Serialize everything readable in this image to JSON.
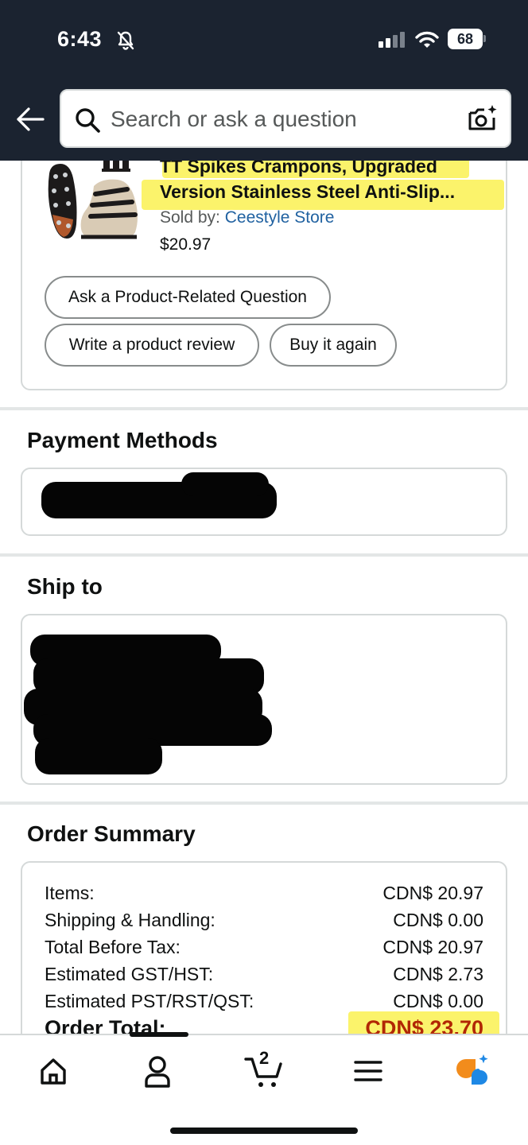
{
  "status_bar": {
    "time": "6:43",
    "battery": "68"
  },
  "search": {
    "placeholder": "Search or ask a question"
  },
  "product": {
    "title_line1": "TT Spikes Crampons, Upgraded",
    "title_line2": "Version Stainless Steel Anti-Slip...",
    "sold_by_label": "Sold by:",
    "seller": "Ceestyle Store",
    "price": "$20.97",
    "image_icon": "crampon-product-image"
  },
  "actions": {
    "ask_question": "Ask a Product-Related Question",
    "write_review": "Write a product review",
    "buy_again": "Buy it again"
  },
  "payment": {
    "heading": "Payment Methods"
  },
  "ship_to": {
    "heading": "Ship to"
  },
  "order_summary": {
    "heading": "Order Summary",
    "rows": [
      {
        "label": "Items:",
        "value": "CDN$ 20.97"
      },
      {
        "label": "Shipping & Handling:",
        "value": "CDN$ 0.00"
      },
      {
        "label": "Total Before Tax:",
        "value": "CDN$ 20.97"
      },
      {
        "label": "Estimated GST/HST:",
        "value": "CDN$ 2.73"
      },
      {
        "label": "Estimated PST/RST/QST:",
        "value": "CDN$ 0.00"
      }
    ],
    "total_label": "Order Total:",
    "total_value": "CDN$ 23.70"
  },
  "bottom_nav": {
    "cart_count": "2",
    "items": [
      "home-icon",
      "account-icon",
      "cart-icon",
      "menu-icon",
      "rufus-assistant-icon"
    ]
  },
  "colors": {
    "header_bg": "#1b2330",
    "highlight": "#fbf36b",
    "link": "#2162a1",
    "total_red": "#b12704",
    "assistant_orange": "#f28c1c",
    "assistant_blue": "#1e88e5"
  }
}
